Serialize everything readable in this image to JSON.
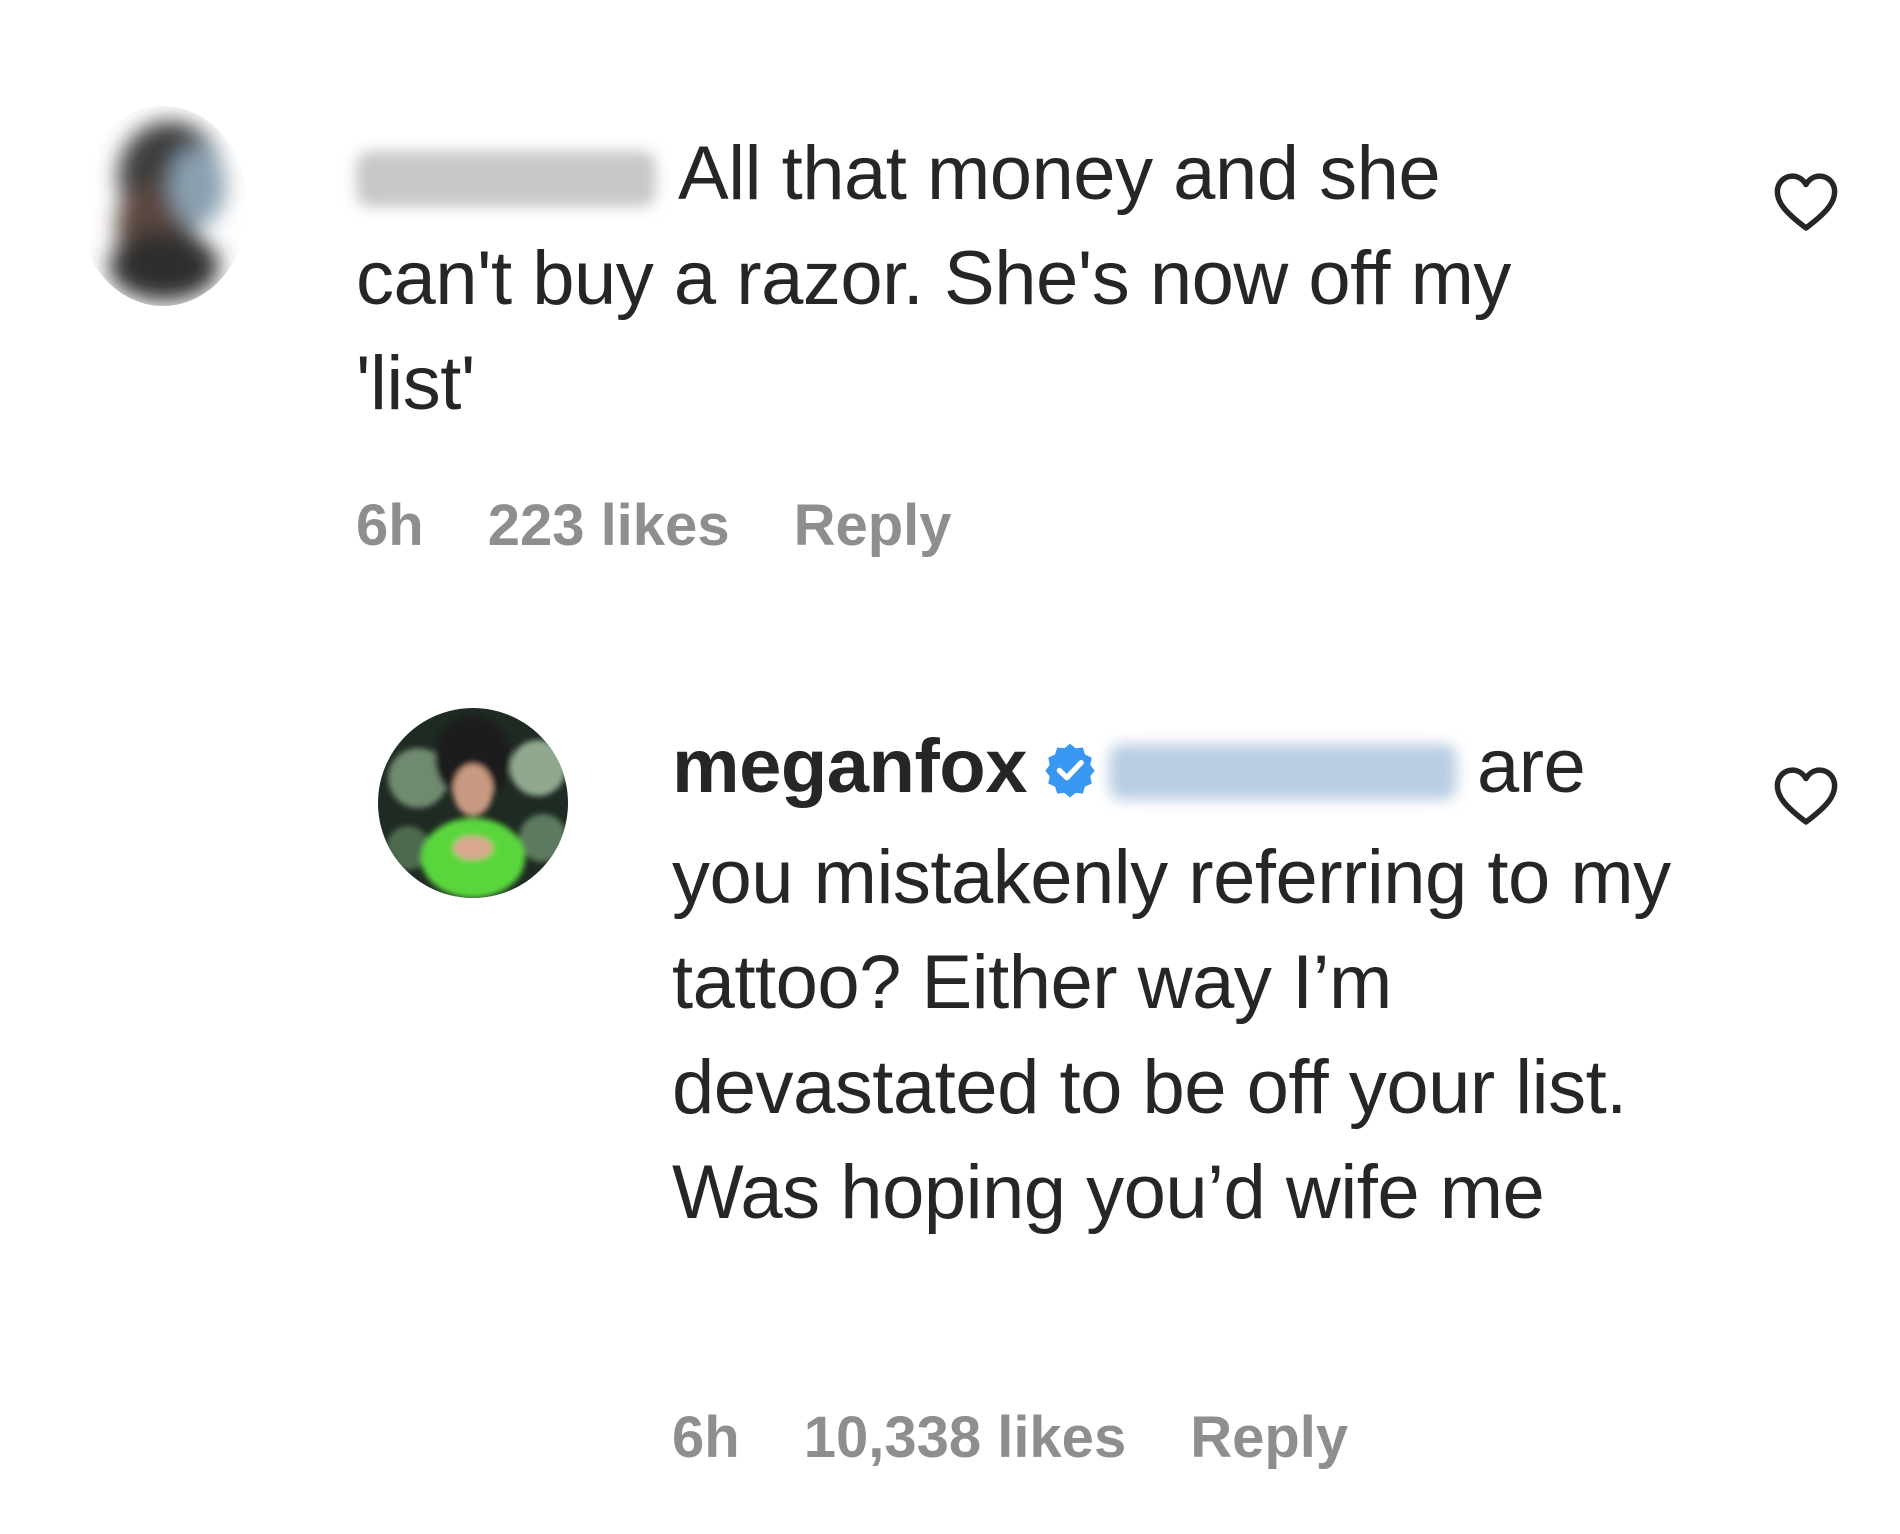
{
  "comments": [
    {
      "username_hidden": true,
      "text": "All that money and she can't buy a razor. She's now off my 'list'",
      "time": "6h",
      "likes": "223 likes",
      "reply_label": "Reply"
    },
    {
      "username": "meganfox",
      "verified": true,
      "text": "are you mistakenly referring to my tattoo? Either way I’m devastated to be off your list. Was hoping you’d wife me",
      "time": "6h",
      "likes": "10,338 likes",
      "reply_label": "Reply"
    }
  ],
  "icons": {
    "like": "heart-outline-icon",
    "verified": "verified-badge-icon"
  },
  "colors": {
    "text": "#262626",
    "meta": "#8e8e8e",
    "verified": "#3897f0",
    "avatar2_accent": "#5ad63c"
  }
}
